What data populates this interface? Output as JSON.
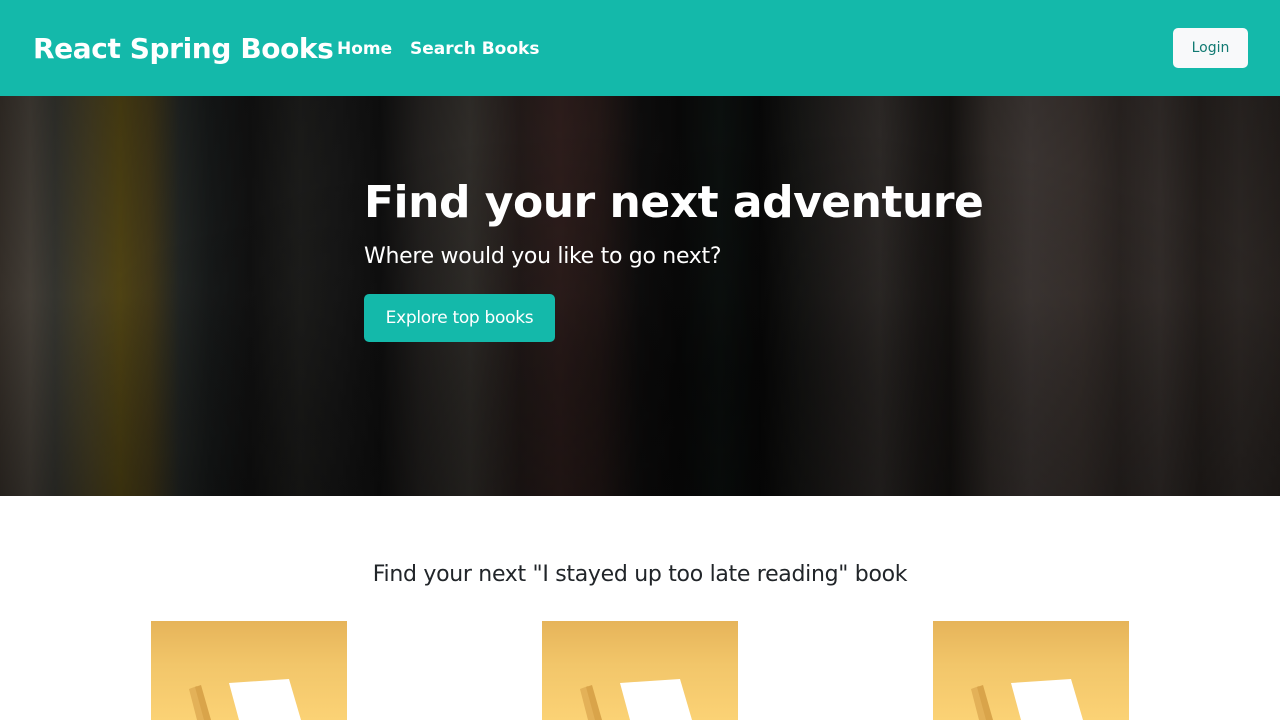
{
  "navbar": {
    "brand": "React Spring Books",
    "links": [
      {
        "label": "Home"
      },
      {
        "label": "Search Books"
      }
    ],
    "login_label": "Login"
  },
  "hero": {
    "title": "Find your next adventure",
    "subtitle": "Where would you like to go next?",
    "cta_label": "Explore top books"
  },
  "books_section": {
    "title": "Find your next \"I stayed up too late reading\" book",
    "cards": [
      {
        "icon": "book-cover-icon"
      },
      {
        "icon": "book-cover-icon"
      },
      {
        "icon": "book-cover-icon"
      }
    ]
  },
  "colors": {
    "brand_teal": "#14b9aa",
    "login_text": "#117a72",
    "book_card_yellow": "#f2c66a"
  }
}
